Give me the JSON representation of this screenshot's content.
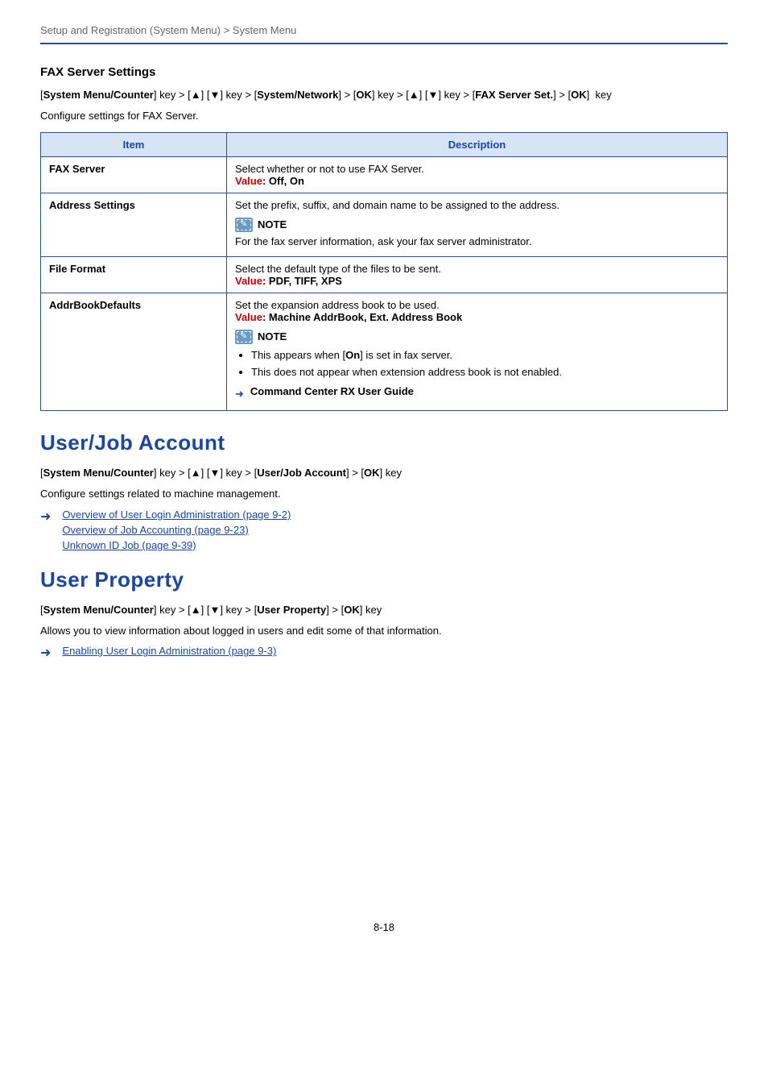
{
  "breadcrumb": "Setup and Registration (System Menu) > System Menu",
  "fax": {
    "heading": "FAX Server Settings",
    "path_prefix": "[",
    "path_parts": {
      "smc": "System Menu/Counter",
      "sysnet": "System/Network",
      "ok": "OK",
      "faxset": "FAX Server Set."
    },
    "path_full_html": "[System Menu/Counter] key > [▲] [▼] key > [System/Network] > [OK] key > [▲] [▼] key > [FAX Server Set.] > [OK]  key",
    "intro": "Configure settings for FAX Server.",
    "col_item": "Item",
    "col_desc": "Description",
    "rows": {
      "faxserver": {
        "item": "FAX Server",
        "desc": "Select whether or not to use FAX Server.",
        "value_label": "Value",
        "value_body": ": Off, On"
      },
      "address": {
        "item": "Address Settings",
        "desc": "Set the prefix, suffix, and domain name to be assigned to the address.",
        "note_label": "NOTE",
        "note_text": "For the fax server information, ask your fax server administrator."
      },
      "fileformat": {
        "item": "File Format",
        "desc": "Select the default type of the files to be sent.",
        "value_label": "Value",
        "value_body": ": PDF, TIFF, XPS"
      },
      "addrbook": {
        "item": "AddrBookDefaults",
        "desc": "Set the expansion address book to be used.",
        "value_label": "Value",
        "value_body": ": Machine AddrBook, Ext. Address Book",
        "note_label": "NOTE",
        "bullet1_pre": "This appears when [",
        "bullet1_bold": "On",
        "bullet1_post": "] is set in fax server.",
        "bullet2": "This does not appear when extension address book is not enabled.",
        "ref": "Command Center RX User Guide"
      }
    }
  },
  "userjob": {
    "title": "User/Job Account",
    "path": "[System Menu/Counter] key > [▲] [▼] key > [User/Job Account] > [OK] key",
    "intro": "Configure settings related to machine management.",
    "links": {
      "l1": "Overview of User Login Administration (page 9-2)",
      "l2": "Overview of Job Accounting (page 9-23)",
      "l3": "Unknown ID Job (page 9-39)"
    }
  },
  "userprop": {
    "title": "User Property",
    "path": "[System Menu/Counter] key > [▲] [▼] key > [User Property] > [OK] key",
    "intro": "Allows you to view information about logged in users and edit some of that information.",
    "link": "Enabling User Login Administration (page 9-3)"
  },
  "pagenum": "8-18"
}
